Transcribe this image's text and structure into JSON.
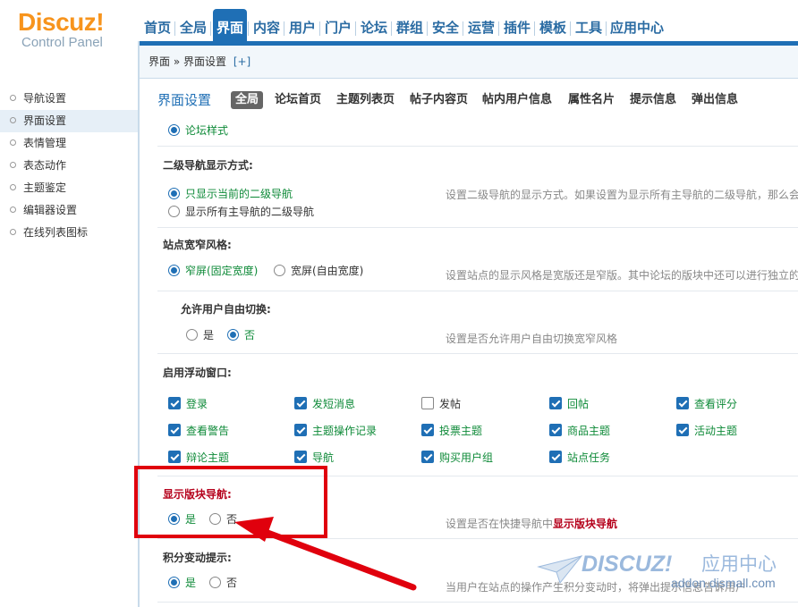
{
  "logo": {
    "main": "Discuz",
    "bang": "!",
    "sub": "Control Panel"
  },
  "topnav": [
    {
      "label": "首页",
      "active": false
    },
    {
      "label": "全局",
      "active": false
    },
    {
      "label": "界面",
      "active": true
    },
    {
      "label": "内容",
      "active": false
    },
    {
      "label": "用户",
      "active": false
    },
    {
      "label": "门户",
      "active": false
    },
    {
      "label": "论坛",
      "active": false
    },
    {
      "label": "群组",
      "active": false
    },
    {
      "label": "安全",
      "active": false
    },
    {
      "label": "运营",
      "active": false
    },
    {
      "label": "插件",
      "active": false
    },
    {
      "label": "模板",
      "active": false
    },
    {
      "label": "工具",
      "active": false
    },
    {
      "label": "应用中心",
      "active": false
    }
  ],
  "breadcrumb": {
    "text": "界面 » 界面设置",
    "add": "[+]"
  },
  "sidebar": [
    {
      "label": "导航设置",
      "active": false
    },
    {
      "label": "界面设置",
      "active": true
    },
    {
      "label": "表情管理",
      "active": false
    },
    {
      "label": "表态动作",
      "active": false
    },
    {
      "label": "主题鉴定",
      "active": false
    },
    {
      "label": "编辑器设置",
      "active": false
    },
    {
      "label": "在线列表图标",
      "active": false
    }
  ],
  "subnav": {
    "title": "界面设置",
    "items": [
      {
        "label": "全局",
        "active": true
      },
      {
        "label": "论坛首页",
        "active": false
      },
      {
        "label": "主题列表页",
        "active": false
      },
      {
        "label": "帖子内容页",
        "active": false
      },
      {
        "label": "帖内用户信息",
        "active": false
      },
      {
        "label": "属性名片",
        "active": false
      },
      {
        "label": "提示信息",
        "active": false
      },
      {
        "label": "弹出信息",
        "active": false
      }
    ]
  },
  "settings": {
    "forum_style": "论坛样式",
    "subnav": {
      "label": "二级导航显示方式:",
      "opt1": "只显示当前的二级导航",
      "opt2": "显示所有主导航的二级导航",
      "desc": "设置二级导航的显示方式。如果设置为显示所有主导航的二级导航，那么会"
    },
    "width": {
      "label": "站点宽窄风格:",
      "opt1": "窄屏(固定宽度)",
      "opt2": "宽屏(自由宽度)",
      "desc": "设置站点的显示风格是宽版还是窄版。其中论坛的版块中还可以进行独立的"
    },
    "switch": {
      "label": "允许用户自由切换:",
      "opt_yes": "是",
      "opt_no": "否",
      "desc": "设置是否允许用户自由切换宽窄风格"
    },
    "float": {
      "label": "启用浮动窗口:",
      "items": [
        {
          "label": "登录",
          "checked": true
        },
        {
          "label": "发短消息",
          "checked": true
        },
        {
          "label": "发帖",
          "checked": false
        },
        {
          "label": "回帖",
          "checked": true
        },
        {
          "label": "查看评分",
          "checked": true
        },
        {
          "label": "查看警告",
          "checked": true
        },
        {
          "label": "主题操作记录",
          "checked": true
        },
        {
          "label": "投票主题",
          "checked": true
        },
        {
          "label": "商品主题",
          "checked": true
        },
        {
          "label": "活动主题",
          "checked": true
        },
        {
          "label": "辩论主题",
          "checked": true
        },
        {
          "label": "导航",
          "checked": true
        },
        {
          "label": "购买用户组",
          "checked": true
        },
        {
          "label": "站点任务",
          "checked": true
        }
      ]
    },
    "blocknav": {
      "label": "显示版块导航:",
      "opt_yes": "是",
      "opt_no": "否",
      "desc_prefix": "设置是否在快捷导航中",
      "desc_bold": "显示版块导航"
    },
    "credit": {
      "label": "积分变动提示:",
      "opt_yes": "是",
      "opt_no": "否",
      "desc": "当用户在站点的操作产生积分变动时，将弹出提示信息告诉用户"
    }
  },
  "watermark": {
    "brand": "DISCUZ!",
    "cn": "应用中心",
    "site": "addon.dismall.com"
  },
  "colors": {
    "brand_blue": "#1f6fb5",
    "logo_orange": "#f7941d",
    "highlight_red": "#e0000d",
    "green_text": "#0e8a38"
  }
}
